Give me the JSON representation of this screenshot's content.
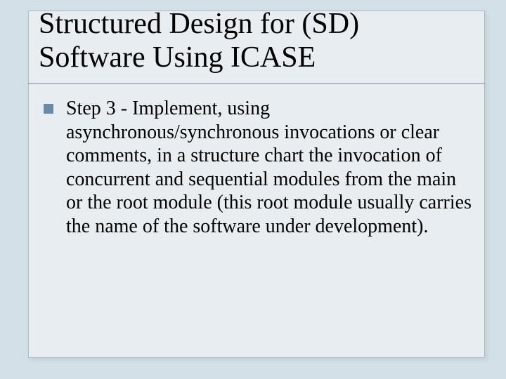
{
  "slide": {
    "title_line1": "Structured Design for (SD)",
    "title_line2": "Software Using ICASE",
    "bullet_text": "Step 3 - Implement, using asynchronous/synchronous invocations or clear comments, in a structure chart the invocation of concurrent and sequential modules from the main or the root module (this root module usually carries the name of the software under development)."
  }
}
